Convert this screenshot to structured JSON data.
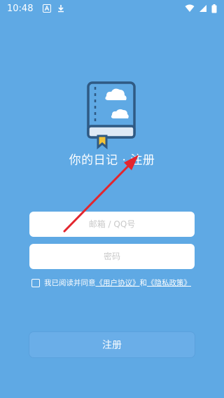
{
  "status_bar": {
    "time": "10:48",
    "icons": [
      "notification-a-icon",
      "download-icon",
      "wifi-icon",
      "signal-icon",
      "battery-icon"
    ]
  },
  "app": {
    "title": "你的日记 · 注册"
  },
  "form": {
    "email_placeholder": "邮箱 / QQ号",
    "password_placeholder": "密码",
    "agree_prefix": "我已阅读并同意",
    "user_agreement": "《用户协议》",
    "and": "和",
    "privacy_policy": "《隐私政策》",
    "register_label": "注册"
  },
  "colors": {
    "background": "#5fa9e4",
    "book_cover": "#5fa9e4",
    "book_outline": "#2f5a84",
    "annotation_arrow": "#e3262e"
  }
}
